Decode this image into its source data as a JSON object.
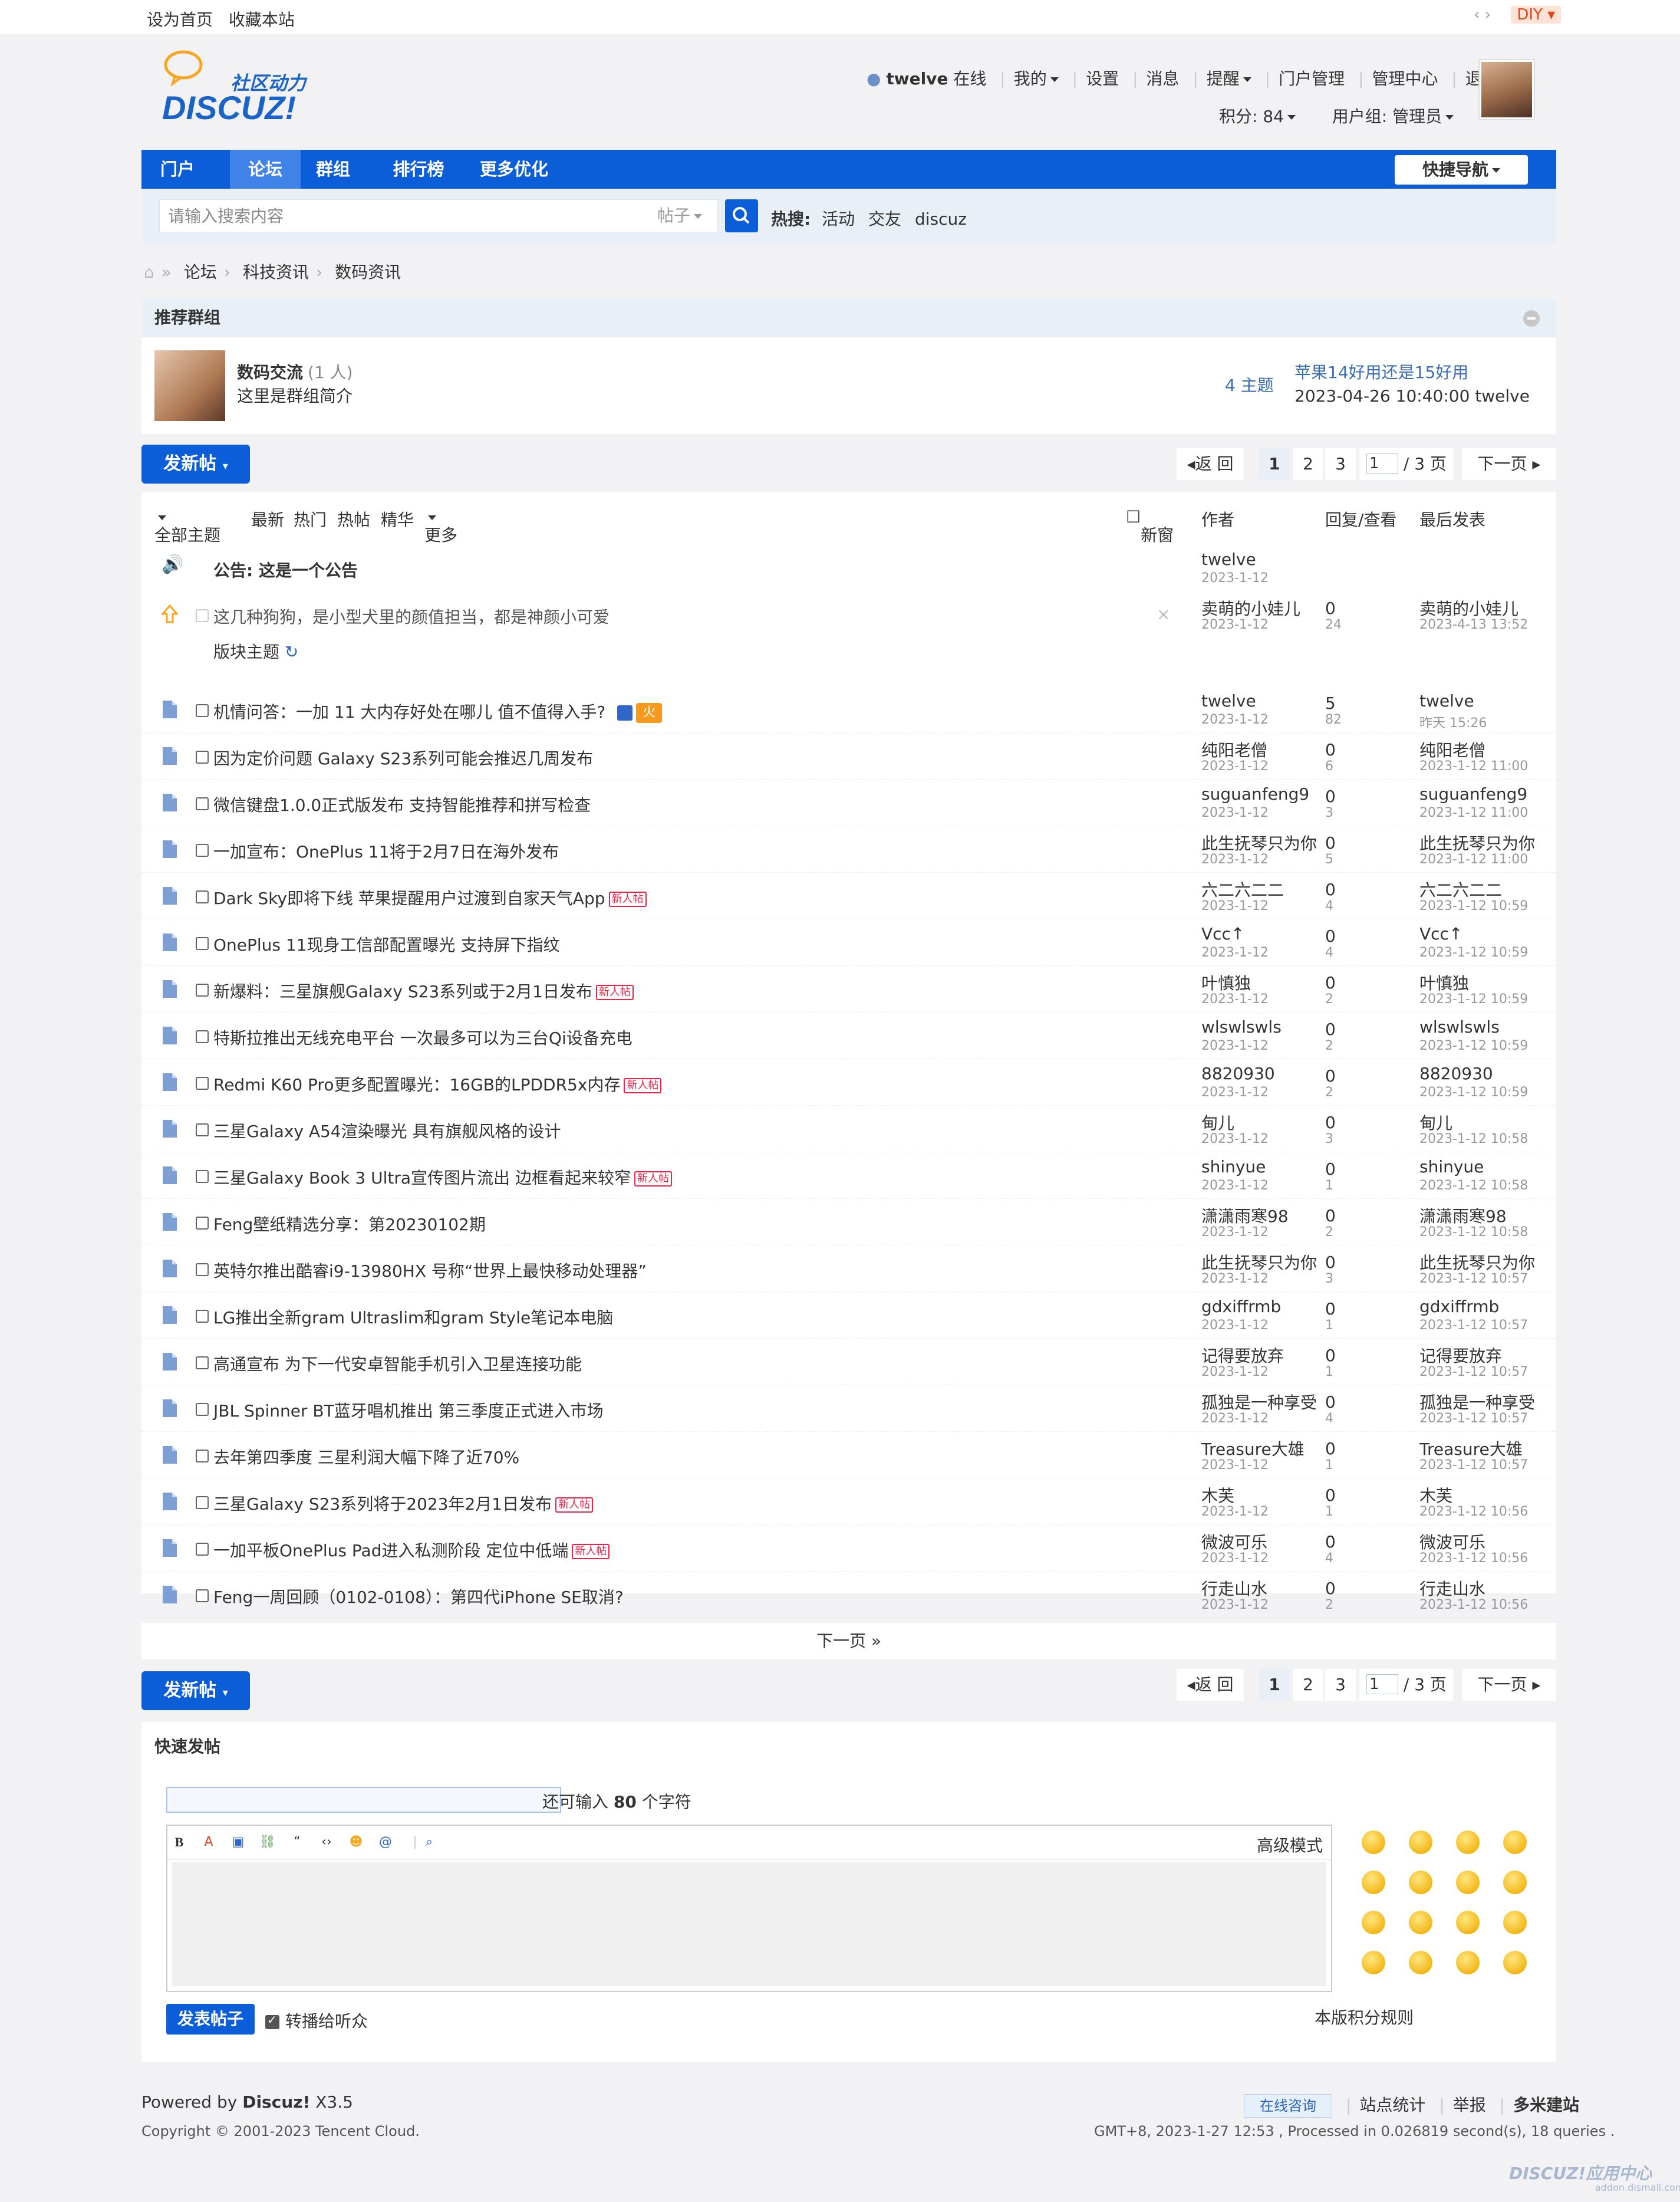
{
  "topbar": {
    "set_home": "设为首页",
    "bookmark": "收藏本站",
    "diy": "DIY"
  },
  "logo": {
    "cn": "社区动力",
    "en": "DISCUZ!"
  },
  "usernav": {
    "username": "twelve",
    "online": "在线",
    "items": [
      "我的",
      "设置",
      "消息",
      "提醒",
      "门户管理",
      "管理中心",
      "退出"
    ],
    "credits": "积分: 84",
    "usergroup": "用户组: 管理员"
  },
  "mainnav": {
    "items": [
      "门户",
      "论坛",
      "群组",
      "排行榜",
      "更多优化"
    ],
    "active": "论坛",
    "quick": "快捷导航"
  },
  "search": {
    "placeholder": "请输入搜索内容",
    "type": "帖子",
    "hot_label": "热搜:",
    "hot": [
      "活动",
      "交友",
      "discuz"
    ]
  },
  "breadcrumb": [
    "论坛",
    "科技资讯",
    "数码资讯"
  ],
  "group": {
    "header": "推荐群组",
    "name": "数码交流",
    "members": "(1 人)",
    "desc": "这里是群组简介",
    "topics": "4 主题",
    "last_title": "苹果14好用还是15好用",
    "last_info": "2023-04-26 10:40:00 twelve"
  },
  "pager": {
    "post_button": "发新帖",
    "back": "返 回",
    "pages": [
      "1",
      "2",
      "3"
    ],
    "current": "1",
    "total": "/ 3 页",
    "next": "下一页"
  },
  "thread_head": {
    "filters": [
      "全部主题",
      "最新",
      "热门",
      "热帖",
      "精华",
      "更多"
    ],
    "new_window": "新窗",
    "author": "作者",
    "replies": "回复/查看",
    "last": "最后发表"
  },
  "announcement": {
    "title": "公告: 这是一个公告",
    "author": "twelve",
    "date": "2023-1-12"
  },
  "sticky": {
    "title": "这几种狗狗，是小型犬里的颜值担当，都是神颜小可爱",
    "author": "卖萌的小娃儿",
    "date": "2023-1-12",
    "replies": "0",
    "views": "24",
    "last": "卖萌的小娃儿",
    "last_date": "2023-4-13 13:52"
  },
  "section_label": "版块主题",
  "threads": [
    {
      "title": "机情问答：一加 11 大内存好处在哪儿 值不值得入手?",
      "tag": "hot",
      "author": "twelve",
      "date": "2023-1-12",
      "replies": "5",
      "views": "82",
      "last": "twelve",
      "last_date": "昨天 15:26"
    },
    {
      "title": "因为定价问题 Galaxy S23系列可能会推迟几周发布",
      "tag": "",
      "author": "纯阳老僧",
      "date": "2023-1-12",
      "replies": "0",
      "views": "6",
      "last": "纯阳老僧",
      "last_date": "2023-1-12 11:00"
    },
    {
      "title": "微信键盘1.0.0正式版发布 支持智能推荐和拼写检查",
      "tag": "",
      "author": "suguanfeng9",
      "date": "2023-1-12",
      "replies": "0",
      "views": "3",
      "last": "suguanfeng9",
      "last_date": "2023-1-12 11:00"
    },
    {
      "title": "一加宣布：OnePlus 11将于2月7日在海外发布",
      "tag": "",
      "author": "此生抚琴只为你",
      "date": "2023-1-12",
      "replies": "0",
      "views": "5",
      "last": "此生抚琴只为你",
      "last_date": "2023-1-12 11:00"
    },
    {
      "title": "Dark Sky即将下线 苹果提醒用户过渡到自家天气App",
      "tag": "new",
      "author": "六二六二二",
      "date": "2023-1-12",
      "replies": "0",
      "views": "4",
      "last": "六二六二二",
      "last_date": "2023-1-12 10:59"
    },
    {
      "title": "OnePlus 11现身工信部配置曝光 支持屏下指纹",
      "tag": "",
      "author": "Vcc↑",
      "date": "2023-1-12",
      "replies": "0",
      "views": "4",
      "last": "Vcc↑",
      "last_date": "2023-1-12 10:59"
    },
    {
      "title": "新爆料：三星旗舰Galaxy S23系列或于2月1日发布",
      "tag": "new",
      "author": "叶慎独",
      "date": "2023-1-12",
      "replies": "0",
      "views": "2",
      "last": "叶慎独",
      "last_date": "2023-1-12 10:59"
    },
    {
      "title": "特斯拉推出无线充电平台 一次最多可以为三台Qi设备充电",
      "tag": "",
      "author": "wlswlswls",
      "date": "2023-1-12",
      "replies": "0",
      "views": "2",
      "last": "wlswlswls",
      "last_date": "2023-1-12 10:59"
    },
    {
      "title": "Redmi K60 Pro更多配置曝光：16GB的LPDDR5x内存",
      "tag": "new",
      "author": "8820930",
      "date": "2023-1-12",
      "replies": "0",
      "views": "2",
      "last": "8820930",
      "last_date": "2023-1-12 10:59"
    },
    {
      "title": "三星Galaxy A54渲染曝光 具有旗舰风格的设计",
      "tag": "",
      "author": "甸儿",
      "date": "2023-1-12",
      "replies": "0",
      "views": "3",
      "last": "甸儿",
      "last_date": "2023-1-12 10:58"
    },
    {
      "title": "三星Galaxy Book 3 Ultra宣传图片流出 边框看起来较窄",
      "tag": "new",
      "author": "shinyue",
      "date": "2023-1-12",
      "replies": "0",
      "views": "1",
      "last": "shinyue",
      "last_date": "2023-1-12 10:58"
    },
    {
      "title": "Feng壁纸精选分享：第20230102期",
      "tag": "",
      "author": "潇潇雨寒98",
      "date": "2023-1-12",
      "replies": "0",
      "views": "2",
      "last": "潇潇雨寒98",
      "last_date": "2023-1-12 10:58"
    },
    {
      "title": "英特尔推出酷睿i9-13980HX 号称“世界上最快移动处理器”",
      "tag": "",
      "author": "此生抚琴只为你",
      "date": "2023-1-12",
      "replies": "0",
      "views": "3",
      "last": "此生抚琴只为你",
      "last_date": "2023-1-12 10:57"
    },
    {
      "title": "LG推出全新gram Ultraslim和gram Style笔记本电脑",
      "tag": "",
      "author": "gdxiffrmb",
      "date": "2023-1-12",
      "replies": "0",
      "views": "1",
      "last": "gdxiffrmb",
      "last_date": "2023-1-12 10:57"
    },
    {
      "title": "高通宣布 为下一代安卓智能手机引入卫星连接功能",
      "tag": "",
      "author": "记得要放弃",
      "date": "2023-1-12",
      "replies": "0",
      "views": "1",
      "last": "记得要放弃",
      "last_date": "2023-1-12 10:57"
    },
    {
      "title": "JBL Spinner BT蓝牙唱机推出 第三季度正式进入市场",
      "tag": "",
      "author": "孤独是一种享受",
      "date": "2023-1-12",
      "replies": "0",
      "views": "4",
      "last": "孤独是一种享受",
      "last_date": "2023-1-12 10:57"
    },
    {
      "title": "去年第四季度 三星利润大幅下降了近70%",
      "tag": "",
      "author": "Treasure大雄",
      "date": "2023-1-12",
      "replies": "0",
      "views": "1",
      "last": "Treasure大雄",
      "last_date": "2023-1-12 10:57"
    },
    {
      "title": "三星Galaxy S23系列将于2023年2月1日发布",
      "tag": "new",
      "author": "木芙",
      "date": "2023-1-12",
      "replies": "0",
      "views": "1",
      "last": "木芙",
      "last_date": "2023-1-12 10:56"
    },
    {
      "title": "一加平板OnePlus Pad进入私测阶段 定位中低端",
      "tag": "new",
      "author": "微波可乐",
      "date": "2023-1-12",
      "replies": "0",
      "views": "4",
      "last": "微波可乐",
      "last_date": "2023-1-12 10:56"
    },
    {
      "title": "Feng一周回顾（0102-0108）：第四代iPhone SE取消?",
      "tag": "",
      "author": "行走山水",
      "date": "2023-1-12",
      "replies": "0",
      "views": "2",
      "last": "行走山水",
      "last_date": "2023-1-12 10:56"
    }
  ],
  "tags": {
    "new": "新人帖",
    "hot": "火"
  },
  "next_page": "下一页 »",
  "quick_post": {
    "header": "快速发帖",
    "remain_prefix": "还可输入",
    "remain_count": "80",
    "remain_suffix": "个字符",
    "advanced": "高级模式",
    "submit": "发表帖子",
    "broadcast": "转播给听众",
    "rules": "本版积分规则"
  },
  "footer": {
    "powered_prefix": "Powered by",
    "powered_brand": "Discuz!",
    "version": "X3.5",
    "copyright": "Copyright © 2001-2023 Tencent Cloud.",
    "consult": "在线咨询",
    "links": [
      "站点统计",
      "举报",
      "多米建站"
    ],
    "info": "GMT+8, 2023-1-27 12:53 , Processed in 0.026819 second(s), 18 queries .",
    "watermark": "DISCUZ!应用中心",
    "watermark_url": "addon.dismall.com"
  },
  "colors": {
    "accent": "#0b5ed7",
    "nav_active": "#3f82e8",
    "link": "#3a6cb5",
    "new_tag": "#e22244",
    "hot_tag": "#f59a1e"
  }
}
